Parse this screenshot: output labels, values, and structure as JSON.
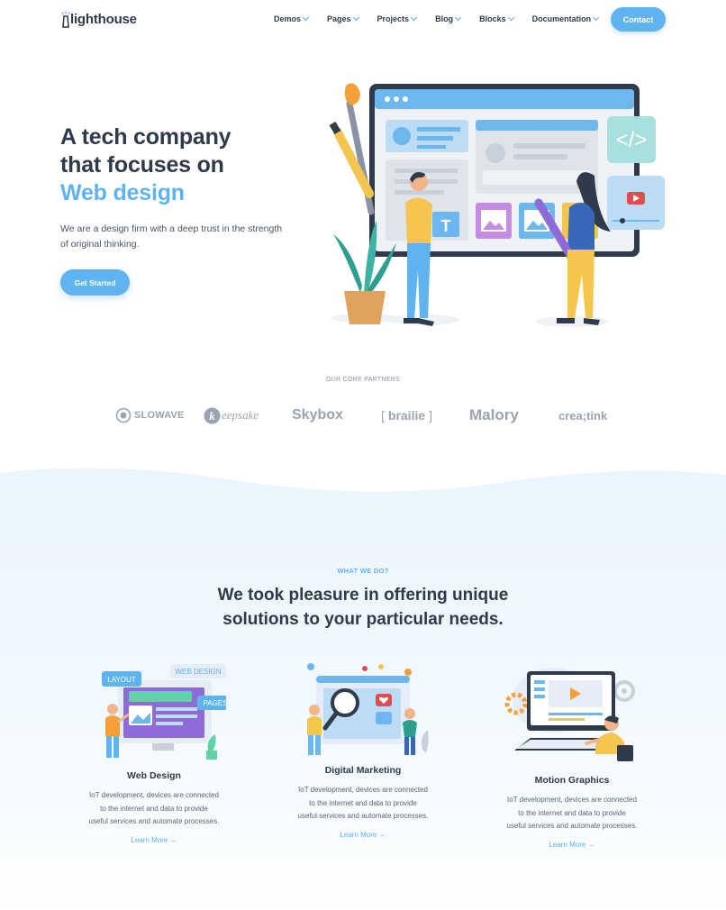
{
  "brand": {
    "name": "lighthouse"
  },
  "nav": {
    "items": [
      {
        "label": "Demos"
      },
      {
        "label": "Pages"
      },
      {
        "label": "Projects"
      },
      {
        "label": "Blog"
      },
      {
        "label": "Blocks"
      },
      {
        "label": "Documentation"
      }
    ],
    "contact_label": "Contact"
  },
  "hero": {
    "title_line1": "A tech company",
    "title_line2": "that focuses on",
    "title_accent": "Web design",
    "subtitle": "We are a design firm with a deep trust in the strength of original thinking.",
    "cta_label": "Get Started"
  },
  "partners": {
    "label": "OUR CORE PARTNERS",
    "logos": [
      "SLOWAVE",
      "eepsake",
      "Skybox",
      "brailie",
      "Malory",
      "crea;tink"
    ]
  },
  "services": {
    "eyebrow": "WHAT WE DO?",
    "title_line1": "We took pleasure in offering unique",
    "title_line2": "solutions to your particular needs.",
    "cards": [
      {
        "title": "Web Design",
        "desc_line1": "IoT development, devices are connected",
        "desc_line2": "to the internet and data to provide",
        "desc_line3": "useful services and automate processes.",
        "link": "Learn More →",
        "art_tags": [
          "LAYOUT",
          "WEB DESIGN",
          "PAGES"
        ]
      },
      {
        "title": "Digital Marketing",
        "desc_line1": "IoT development, devices are connected",
        "desc_line2": "to the internet and data to provide",
        "desc_line3": "useful services and automate processes.",
        "link": "Learn More →"
      },
      {
        "title": "Motion Graphics",
        "desc_line1": "IoT development, devices are connected",
        "desc_line2": "to the internet and data to provide",
        "desc_line3": "useful services and automate processes.",
        "link": "Learn More →"
      }
    ]
  },
  "colors": {
    "accent": "#5fb3ee",
    "heading": "#2f3a4a",
    "section_bg": "#eef7fd"
  }
}
